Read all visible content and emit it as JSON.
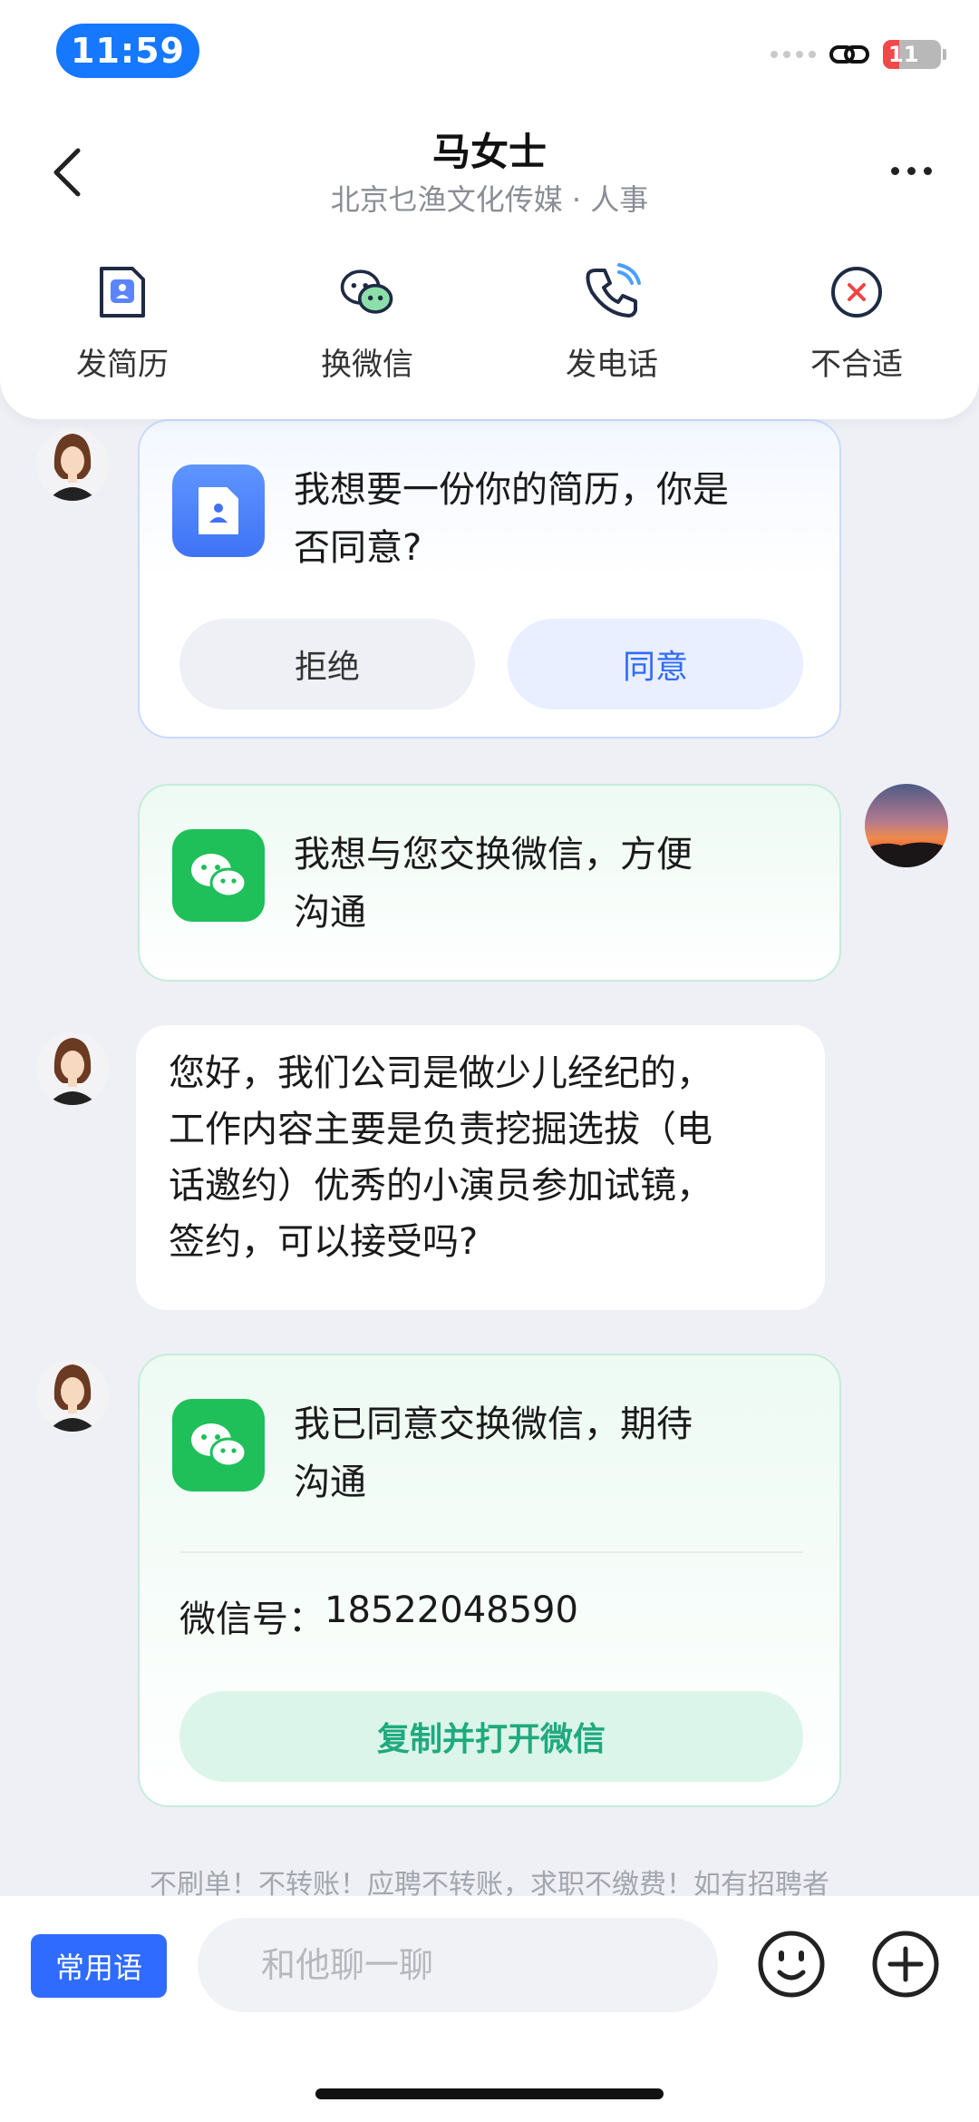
{
  "status_bar": {
    "time": "11:59",
    "battery": "11"
  },
  "header": {
    "contact_name": "马女士",
    "contact_company": "北京乜渔文化传媒 · 人事"
  },
  "actions": [
    {
      "label": "发简历",
      "icon": "resume-icon"
    },
    {
      "label": "换微信",
      "icon": "wechat-icon"
    },
    {
      "label": "发电话",
      "icon": "phone-icon"
    },
    {
      "label": "不合适",
      "icon": "reject-icon"
    }
  ],
  "messages": {
    "resume_request": {
      "text_line1": "我想要一份你的简历，你是",
      "text_line2": "否同意?",
      "reject_label": "拒绝",
      "accept_label": "同意"
    },
    "wechat_request": {
      "text_line1": "我想与您交换微信，方便",
      "text_line2": "沟通"
    },
    "recruiter_text": {
      "line1": "您好，我们公司是做少儿经纪的，",
      "line2": "工作内容主要是负责挖掘选拔（电",
      "line3": "话邀约）优秀的小演员参加试镜，",
      "line4": "签约，可以接受吗?"
    },
    "wechat_accepted": {
      "text_line1": "我已同意交换微信，期待",
      "text_line2": "沟通",
      "wechat_id_label": "微信号：",
      "wechat_id": "18522048590",
      "copy_button": "复制并打开微信"
    }
  },
  "notice": "不刷单！不转账！应聘不转账，求职不缴费！如有招聘者",
  "input_bar": {
    "phrases_label": "常用语",
    "placeholder": "和他聊一聊"
  },
  "colors": {
    "accent": "#2f6bff",
    "wechat_green": "#1fbf5a",
    "copy_text": "#1faa7e",
    "time_pill": "#1677ff"
  }
}
